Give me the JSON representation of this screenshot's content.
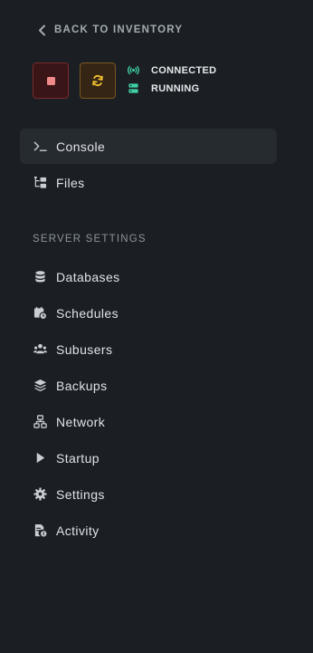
{
  "back_link": {
    "label": "BACK TO INVENTORY",
    "icon": "chevron-left-icon"
  },
  "controls": {
    "stop": {
      "icon": "stop-icon",
      "color": "#f08a8a"
    },
    "restart": {
      "icon": "refresh-icon",
      "color": "#f0c030"
    }
  },
  "status": {
    "connection": {
      "label": "CONNECTED",
      "icon": "broadcast-icon",
      "color": "#3fd0a8"
    },
    "server": {
      "label": "RUNNING",
      "icon": "server-icon",
      "color": "#3fd0a8"
    }
  },
  "main_nav": [
    {
      "label": "Console",
      "icon": "terminal-icon",
      "active": true
    },
    {
      "label": "Files",
      "icon": "folder-tree-icon",
      "active": false
    }
  ],
  "settings_section": {
    "title": "SERVER SETTINGS",
    "items": [
      {
        "label": "Databases",
        "icon": "database-icon"
      },
      {
        "label": "Schedules",
        "icon": "calendar-clock-icon"
      },
      {
        "label": "Subusers",
        "icon": "users-icon"
      },
      {
        "label": "Backups",
        "icon": "layers-icon"
      },
      {
        "label": "Network",
        "icon": "network-icon"
      },
      {
        "label": "Startup",
        "icon": "play-icon"
      },
      {
        "label": "Settings",
        "icon": "gear-icon"
      },
      {
        "label": "Activity",
        "icon": "activity-log-icon"
      }
    ]
  }
}
